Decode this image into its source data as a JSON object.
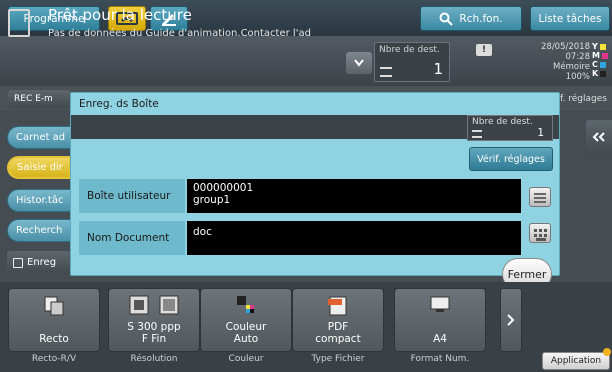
{
  "topbar": {
    "tab_programme": "Programme",
    "search_label": "Rch.fon.",
    "jobs_label": "Liste tâches"
  },
  "status": {
    "title": "Prêt pour la lecture",
    "message": "Pas de données du Guide d'animation.Contacter l'ad",
    "dest_label": "Nbre de dest.",
    "dest_count": "1",
    "warning": "!",
    "date": "28/05/2018",
    "time": "07:28",
    "memory_label": "Mémoire",
    "memory_value": "100%",
    "toner": [
      {
        "letter": "Y",
        "color": "#f5e23a"
      },
      {
        "letter": "M",
        "color": "#e0358c"
      },
      {
        "letter": "C",
        "color": "#2fa6dd"
      },
      {
        "letter": "K",
        "color": "#222222"
      }
    ]
  },
  "subrow": {
    "reg_email": "REC E-m",
    "verif_partial": "f. réglages"
  },
  "sidebar": {
    "carnet": "Carnet ad",
    "saisie": "Saisie dir",
    "histor": "Histor.tâc",
    "recherche": "Recherch",
    "enreg": "Enreg"
  },
  "dialog": {
    "title": "Enreg. ds Boîte",
    "dest_label": "Nbre de dest.",
    "dest_count": "1",
    "verif_button": "Vérif. réglages",
    "boite_label": "Boîte utilisateur",
    "boite_line1": "000000001",
    "boite_line2": "group1",
    "doc_label": "Nom Document",
    "doc_value": "doc",
    "close_button": "Fermer"
  },
  "functions": [
    {
      "value1": "Recto",
      "value2": "",
      "label": "Recto-R/V"
    },
    {
      "value1": "S 300 ppp",
      "value2": "F Fin",
      "label": "Résolution"
    },
    {
      "value1": "Couleur",
      "value2": "Auto",
      "label": "Couleur"
    },
    {
      "value1": "PDF",
      "value2": "compact",
      "label": "Type Fichier"
    },
    {
      "value1": "A4",
      "value2": "",
      "label": "Format Num."
    }
  ],
  "application_button": "Application"
}
